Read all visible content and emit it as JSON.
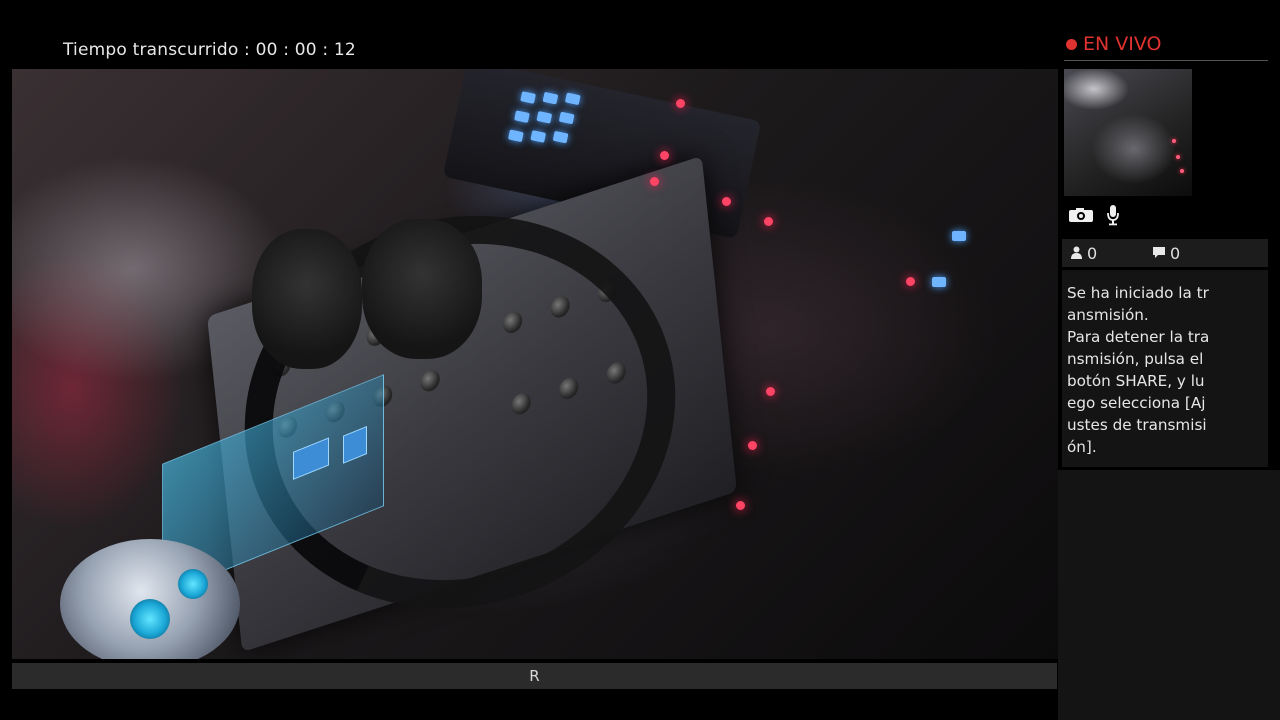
{
  "header": {
    "elapsed_label": "Tiempo transcurrido :",
    "elapsed_value": "00 : 00 : 12"
  },
  "subtitle_bar": {
    "text": "R"
  },
  "sidebar": {
    "live_label": "EN VIVO",
    "viewers_count": "0",
    "comments_count": "0",
    "message_lines": [
      "Se ha iniciado la tr",
      "ansmisión.",
      "Para detener la tra",
      "nsmisión, pulsa el",
      "botón SHARE, y lu",
      "ego selecciona [Aj",
      "ustes de transmisi",
      "ón]."
    ],
    "icons": [
      "camera-icon",
      "microphone-icon",
      "viewers-icon",
      "comments-icon"
    ]
  },
  "colors": {
    "live_red": "#e0322f",
    "panel_bg": "#141414",
    "bar_bg": "#2b2b2b"
  }
}
